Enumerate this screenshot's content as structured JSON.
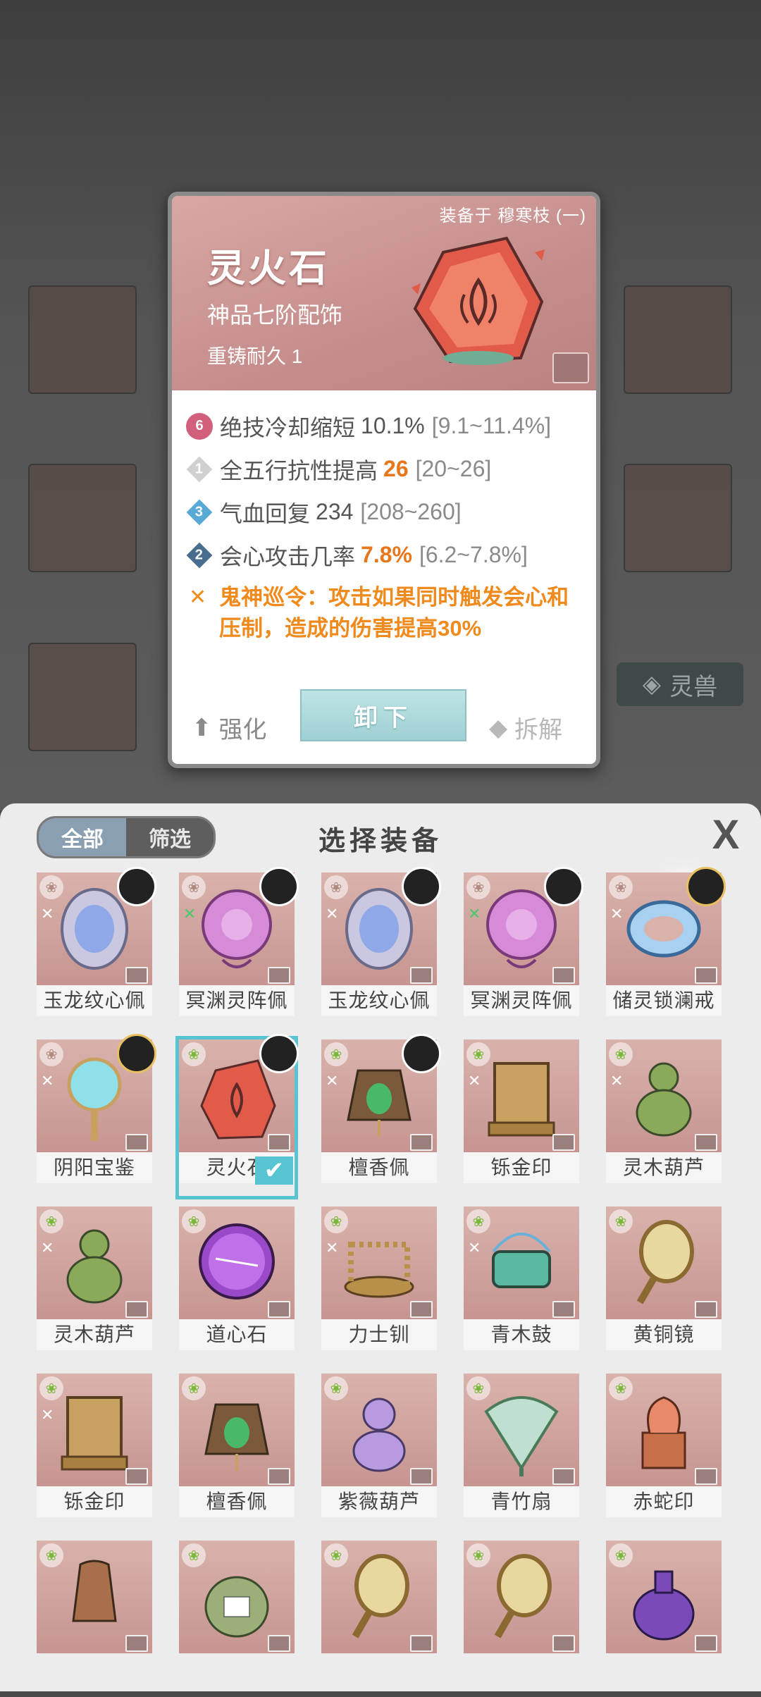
{
  "background": {
    "side_tab_label": "灵兽"
  },
  "detail": {
    "equipped_on": "装备于 穆寒枝 (一)",
    "name": "灵火石",
    "grade": "神品七阶配饰",
    "durability": "重铸耐久 1",
    "stats": [
      {
        "badge": "6",
        "badge_style": "fire",
        "label": "绝技冷却缩短",
        "value": "10.1%",
        "value_highlight": false,
        "range": "[9.1~11.4%]"
      },
      {
        "badge": "1",
        "badge_style": "grey",
        "label": "全五行抗性提高",
        "value": "26",
        "value_highlight": true,
        "range": "[20~26]"
      },
      {
        "badge": "3",
        "badge_style": "blue",
        "label": "气血回复",
        "value": "234",
        "value_highlight": false,
        "range": "[208~260]"
      },
      {
        "badge": "2",
        "badge_style": "navy",
        "label": "会心攻击几率",
        "value": "7.8%",
        "value_highlight": true,
        "range": "[6.2~7.8%]"
      }
    ],
    "special_effect": "鬼神巡令：攻击如果同时触发会心和压制，造成的伤害提高30%",
    "buttons": {
      "enhance": "强化",
      "unequip": "卸下",
      "dismantle": "拆解"
    }
  },
  "panel": {
    "filter_tabs": [
      "全部",
      "筛选"
    ],
    "active_tab": "全部",
    "title": "选择装备",
    "close_label": "X",
    "items": [
      {
        "name": "玉龙纹心佩",
        "icon": "jade-dragon-pendant",
        "set_mark": "grey",
        "portrait": true,
        "selected": false
      },
      {
        "name": "冥渊灵阵佩",
        "icon": "abyss-array-pendant",
        "set_mark": "green",
        "portrait": true,
        "selected": false
      },
      {
        "name": "玉龙纹心佩",
        "icon": "jade-dragon-pendant",
        "set_mark": "grey",
        "portrait": true,
        "selected": false
      },
      {
        "name": "冥渊灵阵佩",
        "icon": "abyss-array-pendant",
        "set_mark": "green",
        "portrait": true,
        "selected": false
      },
      {
        "name": "储灵锁澜戒",
        "icon": "blue-ring",
        "set_mark": "grey",
        "portrait": true,
        "selected": false
      },
      {
        "name": "阴阳宝鉴",
        "icon": "yinyang-mirror",
        "set_mark": "grey",
        "portrait": true,
        "selected": false
      },
      {
        "name": "灵火石",
        "icon": "spirit-fire-stone",
        "set_mark": "none",
        "portrait": true,
        "selected": true
      },
      {
        "name": "檀香佩",
        "icon": "sandalwood-pendant",
        "set_mark": "grey",
        "portrait": true,
        "selected": false
      },
      {
        "name": "铄金印",
        "icon": "golden-seal",
        "set_mark": "grey",
        "portrait": false,
        "selected": false
      },
      {
        "name": "灵木葫芦",
        "icon": "wood-gourd",
        "set_mark": "grey",
        "portrait": false,
        "selected": false
      },
      {
        "name": "灵木葫芦",
        "icon": "wood-gourd",
        "set_mark": "grey",
        "portrait": false,
        "selected": false
      },
      {
        "name": "道心石",
        "icon": "purple-orb",
        "set_mark": "none",
        "portrait": false,
        "selected": false
      },
      {
        "name": "力士钏",
        "icon": "bracelet-coil",
        "set_mark": "grey",
        "portrait": false,
        "selected": false
      },
      {
        "name": "青木鼓",
        "icon": "green-drum",
        "set_mark": "grey",
        "portrait": false,
        "selected": false
      },
      {
        "name": "黄铜镜",
        "icon": "brass-mirror",
        "set_mark": "none",
        "portrait": false,
        "selected": false
      },
      {
        "name": "铄金印",
        "icon": "golden-seal",
        "set_mark": "grey",
        "portrait": false,
        "selected": false
      },
      {
        "name": "檀香佩",
        "icon": "sandalwood-pendant",
        "set_mark": "none",
        "portrait": false,
        "selected": false
      },
      {
        "name": "紫薇葫芦",
        "icon": "purple-gourd",
        "set_mark": "none",
        "portrait": false,
        "selected": false
      },
      {
        "name": "青竹扇",
        "icon": "bamboo-fan",
        "set_mark": "none",
        "portrait": false,
        "selected": false
      },
      {
        "name": "赤蛇印",
        "icon": "red-snake-seal",
        "set_mark": "none",
        "portrait": false,
        "selected": false
      },
      {
        "name": "",
        "icon": "bronze-vessel",
        "set_mark": "none",
        "portrait": false,
        "selected": false
      },
      {
        "name": "",
        "icon": "money-pouch",
        "set_mark": "none",
        "portrait": false,
        "selected": false
      },
      {
        "name": "",
        "icon": "brass-mirror",
        "set_mark": "none",
        "portrait": false,
        "selected": false
      },
      {
        "name": "",
        "icon": "brass-mirror",
        "set_mark": "none",
        "portrait": false,
        "selected": false
      },
      {
        "name": "",
        "icon": "purple-jar",
        "set_mark": "none",
        "portrait": false,
        "selected": false
      }
    ]
  },
  "colors": {
    "selected_outline": "#58c4d2",
    "highlight_value": "#e8761a",
    "special_text": "#f08a1c",
    "card_header": "#c58d8c"
  }
}
